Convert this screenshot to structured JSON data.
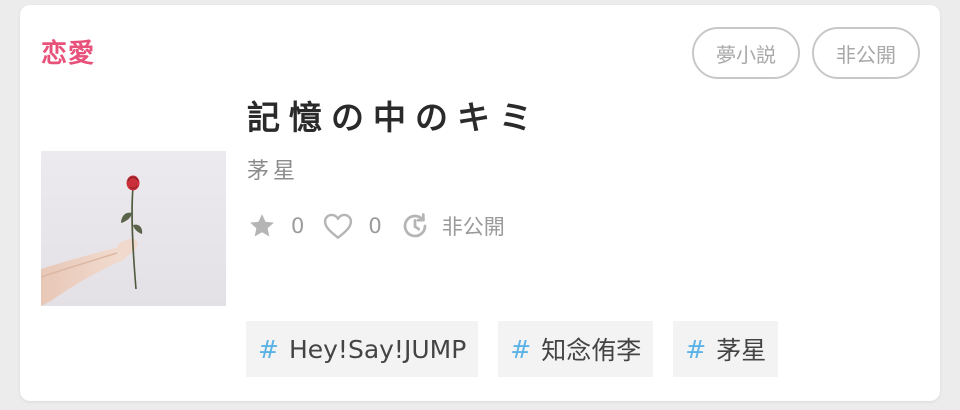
{
  "genre": "恋愛",
  "badges": [
    "夢小説",
    "非公開"
  ],
  "story": {
    "title": "記憶の中のキミ",
    "author": "茅星"
  },
  "stats": {
    "stars": "0",
    "likes": "0",
    "visibility": "非公開"
  },
  "tags": [
    {
      "hash": "#",
      "label": "Hey!Say!JUMP"
    },
    {
      "hash": "#",
      "label": "知念侑李"
    },
    {
      "hash": "#",
      "label": "茅星"
    }
  ],
  "icons": {
    "star": "star-icon",
    "heart": "heart-icon",
    "visibility": "history-icon"
  },
  "colors": {
    "genre": "#e8527a",
    "hash": "#5bb2e6"
  }
}
